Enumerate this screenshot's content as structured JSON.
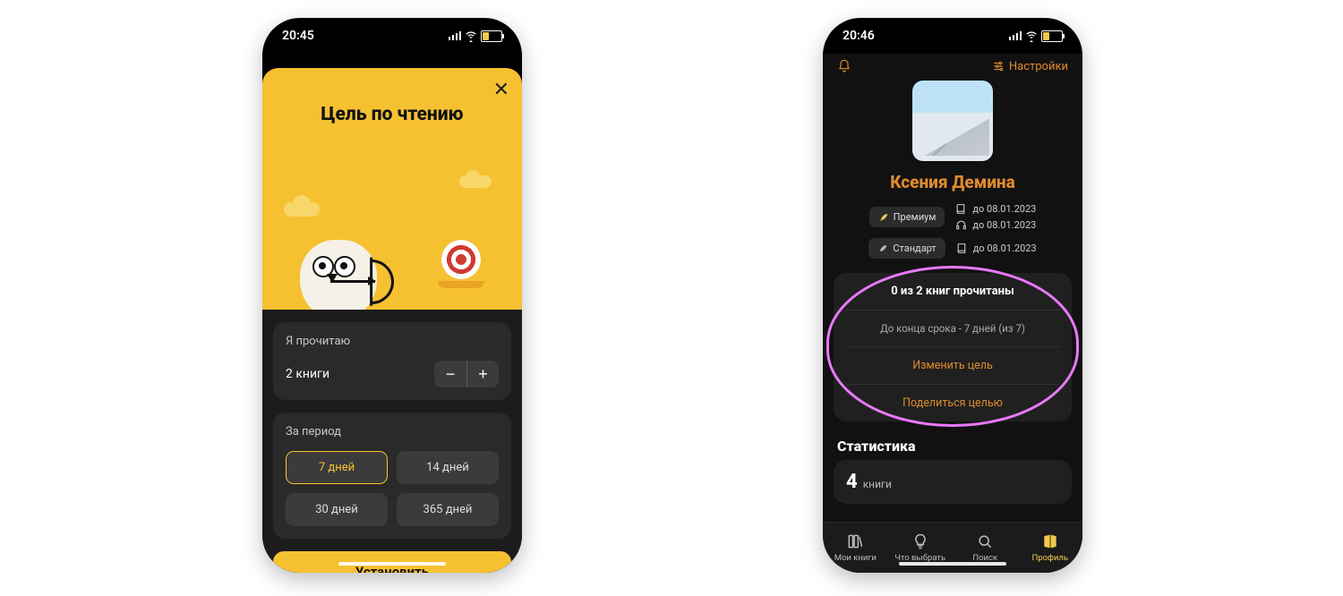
{
  "left": {
    "status": {
      "time": "20:45"
    },
    "sheet": {
      "title": "Цель по чтению",
      "will_read_label": "Я прочитаю",
      "book_count_text": "2 книги",
      "period_label": "За период",
      "periods": [
        "7 дней",
        "14 дней",
        "30 дней",
        "365 дней"
      ],
      "selected_period_index": 0,
      "set_button": "Установить"
    }
  },
  "right": {
    "status": {
      "time": "20:46"
    },
    "topbar": {
      "settings": "Настройки"
    },
    "profile": {
      "name": "Ксения Демина",
      "tiers": {
        "premium_label": "Премиум",
        "standard_label": "Стандарт"
      },
      "sub_dates": {
        "premium_book": "до 08.01.2023",
        "premium_audio": "до 08.01.2023",
        "standard_book": "до 08.01.2023"
      }
    },
    "goal_card": {
      "headline": "0 из 2 книг прочитаны",
      "deadline": "До конца срока - 7 дней (из 7)",
      "edit": "Изменить цель",
      "share": "Поделиться целью"
    },
    "stats": {
      "heading": "Статистика",
      "count_num": "4",
      "count_label": "книги"
    },
    "tabs": {
      "my_books": "Мои книги",
      "what_to_pick": "Что выбрать",
      "search": "Поиск",
      "profile": "Профиль"
    }
  }
}
